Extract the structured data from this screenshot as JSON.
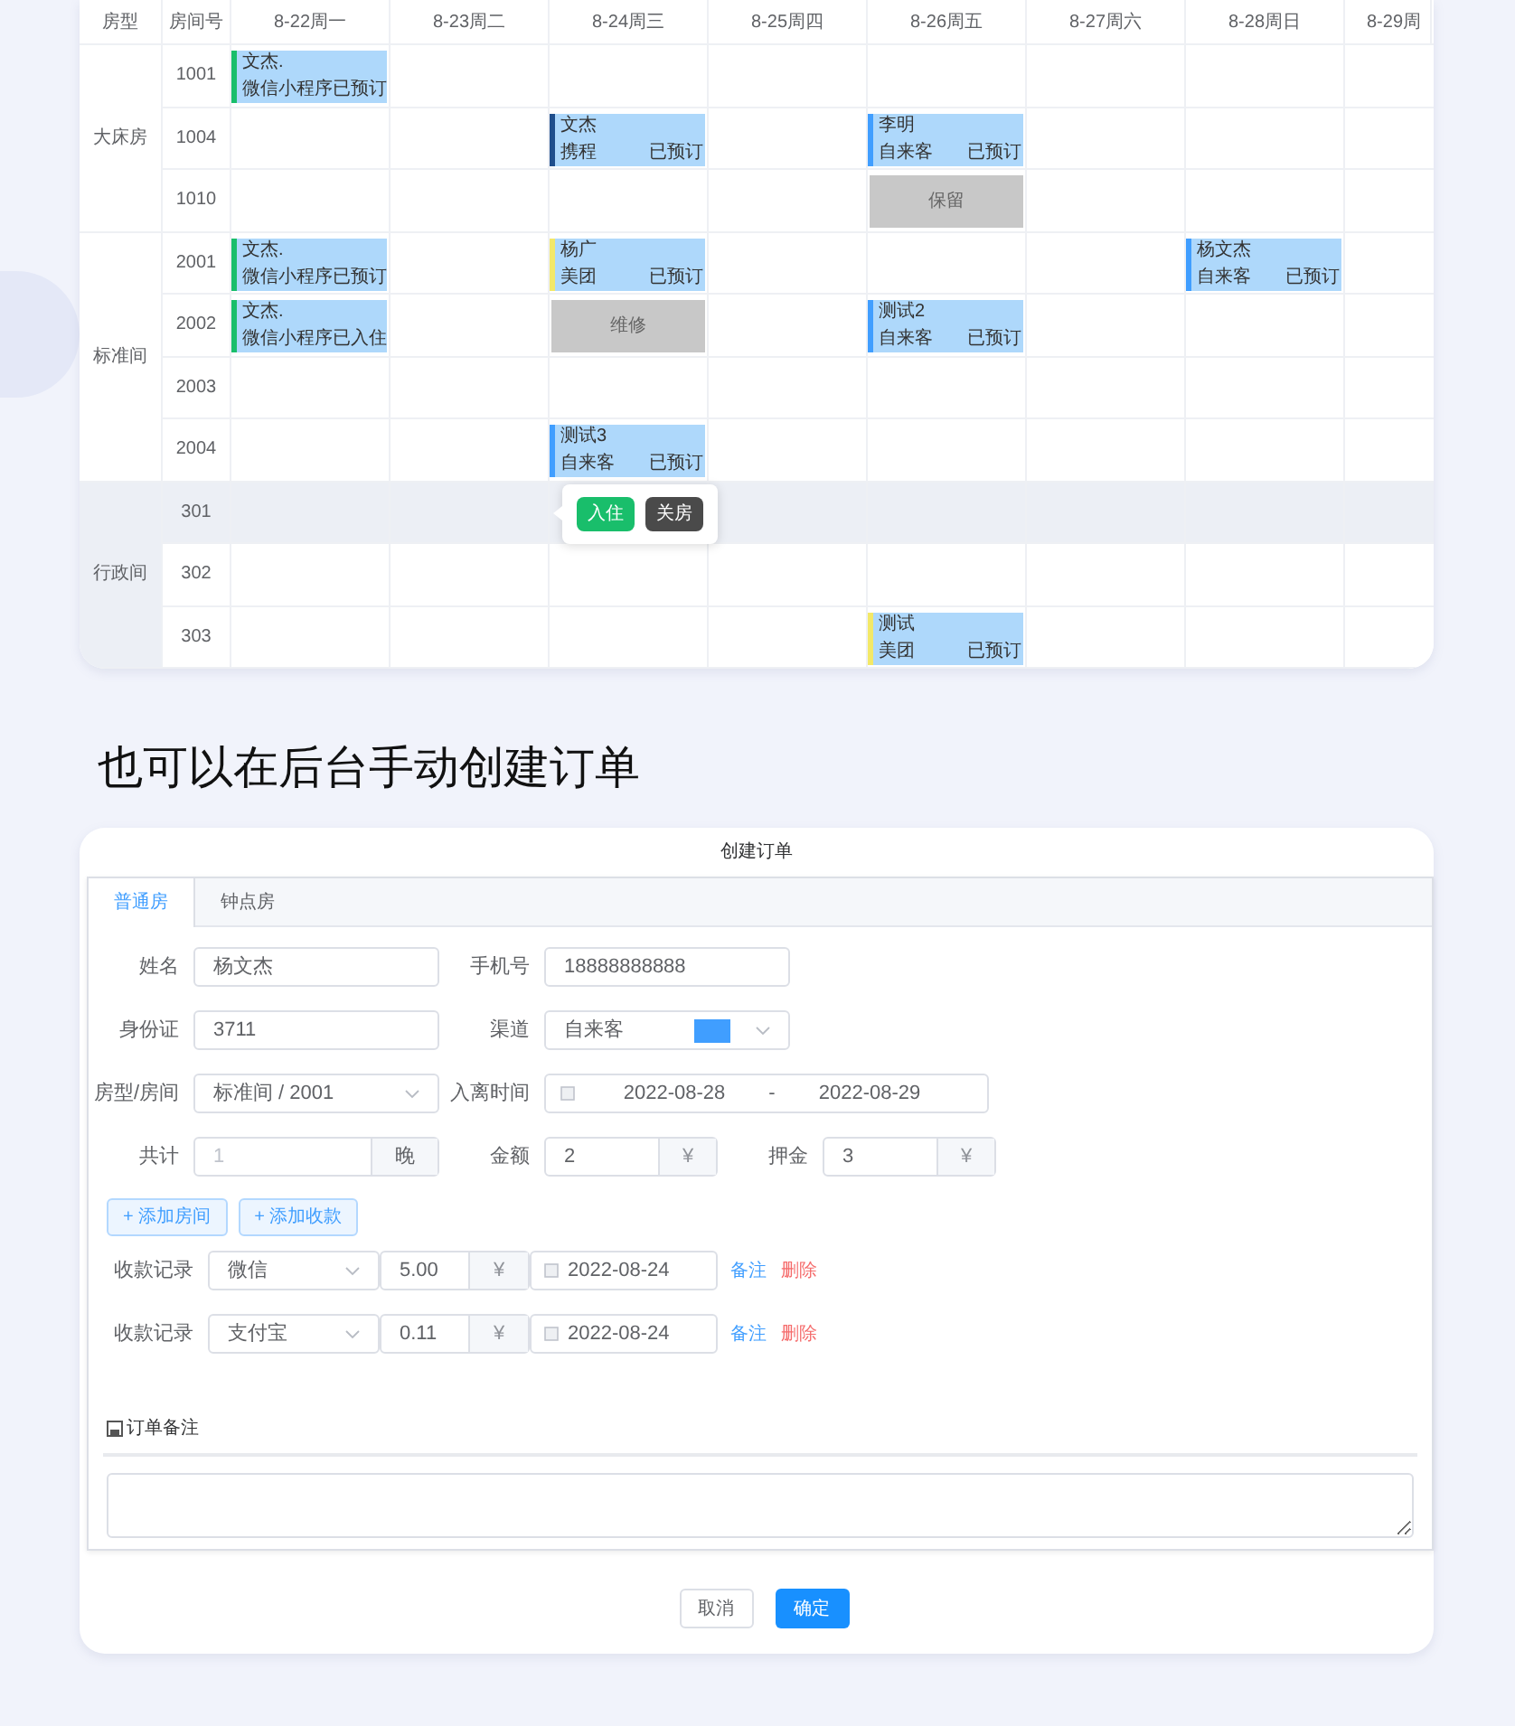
{
  "schedule": {
    "columns": [
      "房型",
      "房间号",
      "8-22周一",
      "8-23周二",
      "8-24周三",
      "8-25周四",
      "8-26周五",
      "8-27周六",
      "8-28周日",
      "8-29周"
    ],
    "room_types": [
      {
        "name": "大床房",
        "highlighted": false,
        "rooms": [
          {
            "number": "1001",
            "highlighted": false,
            "cells": [
              {
                "kind": "booking",
                "name": "文杰.",
                "channel": "微信小程序",
                "status": "已预订",
                "color": "#19be6b"
              },
              {
                "kind": "empty"
              },
              {
                "kind": "empty"
              },
              {
                "kind": "empty"
              },
              {
                "kind": "empty"
              },
              {
                "kind": "empty"
              },
              {
                "kind": "empty"
              },
              {
                "kind": "empty"
              }
            ]
          },
          {
            "number": "1004",
            "highlighted": false,
            "cells": [
              {
                "kind": "empty"
              },
              {
                "kind": "empty"
              },
              {
                "kind": "booking",
                "name": "文杰",
                "channel": "携程",
                "status": "已预订",
                "color": "#1f4e8c"
              },
              {
                "kind": "empty"
              },
              {
                "kind": "booking",
                "name": "李明",
                "channel": "自来客",
                "status": "已预订",
                "color": "#409eff"
              },
              {
                "kind": "empty"
              },
              {
                "kind": "empty"
              },
              {
                "kind": "empty"
              }
            ]
          },
          {
            "number": "1010",
            "highlighted": false,
            "cells": [
              {
                "kind": "empty"
              },
              {
                "kind": "empty"
              },
              {
                "kind": "empty"
              },
              {
                "kind": "empty"
              },
              {
                "kind": "block",
                "label": "保留"
              },
              {
                "kind": "empty"
              },
              {
                "kind": "empty"
              },
              {
                "kind": "empty"
              }
            ]
          }
        ]
      },
      {
        "name": "标准间",
        "highlighted": false,
        "rooms": [
          {
            "number": "2001",
            "highlighted": false,
            "cells": [
              {
                "kind": "booking",
                "name": "文杰.",
                "channel": "微信小程序",
                "status": "已预订",
                "color": "#19be6b"
              },
              {
                "kind": "empty"
              },
              {
                "kind": "booking",
                "name": "杨广",
                "channel": "美团",
                "status": "已预订",
                "color": "#f3e868"
              },
              {
                "kind": "empty"
              },
              {
                "kind": "empty"
              },
              {
                "kind": "empty"
              },
              {
                "kind": "booking",
                "name": "杨文杰",
                "channel": "自来客",
                "status": "已预订",
                "color": "#409eff"
              },
              {
                "kind": "empty"
              }
            ]
          },
          {
            "number": "2002",
            "highlighted": false,
            "cells": [
              {
                "kind": "booking",
                "name": "文杰.",
                "channel": "微信小程序",
                "status": "已入住",
                "color": "#19be6b"
              },
              {
                "kind": "empty"
              },
              {
                "kind": "block",
                "label": "维修"
              },
              {
                "kind": "empty"
              },
              {
                "kind": "booking",
                "name": "测试2",
                "channel": "自来客",
                "status": "已预订",
                "color": "#409eff"
              },
              {
                "kind": "empty"
              },
              {
                "kind": "empty"
              },
              {
                "kind": "empty"
              }
            ]
          },
          {
            "number": "2003",
            "highlighted": false,
            "cells": [
              {
                "kind": "empty"
              },
              {
                "kind": "empty"
              },
              {
                "kind": "empty"
              },
              {
                "kind": "empty"
              },
              {
                "kind": "empty"
              },
              {
                "kind": "empty"
              },
              {
                "kind": "empty"
              },
              {
                "kind": "empty"
              }
            ]
          },
          {
            "number": "2004",
            "highlighted": false,
            "cells": [
              {
                "kind": "empty"
              },
              {
                "kind": "empty"
              },
              {
                "kind": "booking",
                "name": "测试3",
                "channel": "自来客",
                "status": "已预订",
                "color": "#409eff"
              },
              {
                "kind": "empty"
              },
              {
                "kind": "empty"
              },
              {
                "kind": "empty"
              },
              {
                "kind": "empty"
              },
              {
                "kind": "empty"
              }
            ]
          }
        ]
      },
      {
        "name": "行政间",
        "highlighted": true,
        "rooms": [
          {
            "number": "301",
            "highlighted": true,
            "cells": [
              {
                "kind": "empty"
              },
              {
                "kind": "empty"
              },
              {
                "kind": "empty",
                "actions": [
                  {
                    "label": "入住",
                    "kind": "primary"
                  },
                  {
                    "label": "关房",
                    "kind": "dark"
                  }
                ]
              },
              {
                "kind": "empty"
              },
              {
                "kind": "empty"
              },
              {
                "kind": "empty"
              },
              {
                "kind": "empty"
              },
              {
                "kind": "empty"
              }
            ]
          },
          {
            "number": "302",
            "highlighted": false,
            "cells": [
              {
                "kind": "empty"
              },
              {
                "kind": "empty"
              },
              {
                "kind": "empty"
              },
              {
                "kind": "empty"
              },
              {
                "kind": "empty"
              },
              {
                "kind": "empty"
              },
              {
                "kind": "empty"
              },
              {
                "kind": "empty"
              }
            ]
          },
          {
            "number": "303",
            "highlighted": false,
            "cells": [
              {
                "kind": "empty"
              },
              {
                "kind": "empty"
              },
              {
                "kind": "empty"
              },
              {
                "kind": "empty"
              },
              {
                "kind": "booking",
                "name": "测试",
                "channel": "美团",
                "status": "已预订",
                "color": "#f3e868"
              },
              {
                "kind": "empty"
              },
              {
                "kind": "empty"
              },
              {
                "kind": "empty"
              }
            ]
          }
        ]
      }
    ]
  },
  "heading": "也可以在后台手动创建订单",
  "dialog": {
    "title": "创建订单",
    "tabs": [
      {
        "label": "普通房",
        "selected": true
      },
      {
        "label": "钟点房",
        "selected": false
      }
    ],
    "rows": [
      [
        {
          "label": "姓名",
          "kind": "text",
          "value": "杨文杰"
        },
        {
          "label": "手机号",
          "kind": "text",
          "value": "18888888888"
        }
      ],
      [
        {
          "label": "身份证",
          "kind": "text",
          "value": "3711"
        },
        {
          "label": "渠道",
          "kind": "select",
          "value": "自来客",
          "color": "#409eff"
        }
      ],
      [
        {
          "label": "房型/房间",
          "kind": "select",
          "value": "标准间 / 2001"
        },
        {
          "label": "入离时间",
          "kind": "daterange",
          "start": "2022-08-28",
          "separator": "-",
          "end": "2022-08-29"
        }
      ],
      [
        {
          "label": "共计",
          "kind": "unit",
          "value": "1",
          "unit": "晚",
          "disabled": true
        },
        {
          "label": "金额",
          "kind": "unit",
          "value": "2",
          "unit": "¥",
          "disabled": false
        },
        {
          "label": "押金",
          "kind": "unit",
          "value": "3",
          "unit": "¥",
          "disabled": false
        }
      ]
    ],
    "add_buttons": [
      "+ 添加房间",
      "+ 添加收款"
    ],
    "payments": [
      {
        "label": "收款记录",
        "method": "微信",
        "amount": "5.00",
        "unit": "¥",
        "date": "2022-08-24",
        "note": "备注",
        "delete": "删除"
      },
      {
        "label": "收款记录",
        "method": "支付宝",
        "amount": "0.11",
        "unit": "¥",
        "date": "2022-08-24",
        "note": "备注",
        "delete": "删除"
      }
    ],
    "remark_title": "订单备注",
    "buttons": [
      {
        "label": "取消",
        "kind": "default"
      },
      {
        "label": "确定",
        "kind": "primary"
      }
    ]
  }
}
